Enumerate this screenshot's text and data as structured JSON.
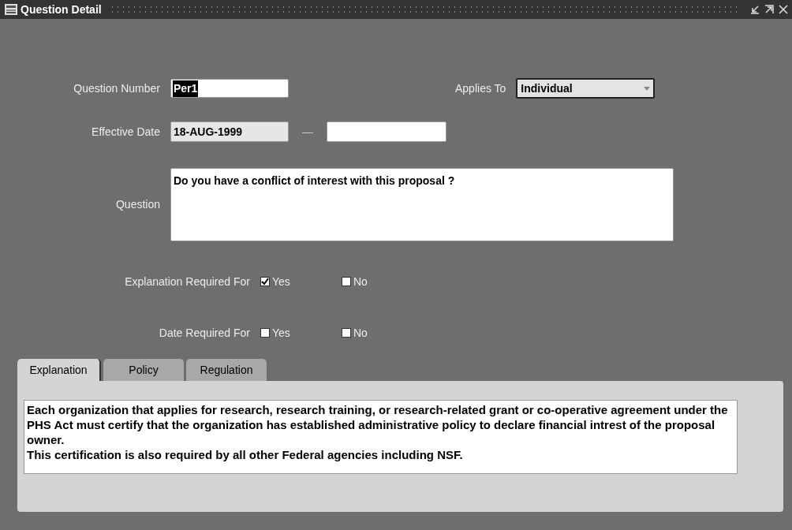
{
  "window": {
    "title": "Question Detail"
  },
  "question_number": {
    "label": "Question Number",
    "value": "Per1",
    "highlighted": true
  },
  "applies_to": {
    "label": "Applies To",
    "value": "Individual"
  },
  "effective_date": {
    "label": "Effective Date",
    "from": "18-AUG-1999",
    "from_readonly": true,
    "separator": "—"
  },
  "question": {
    "label": "Question",
    "value": "Do you have a conflict of interest with this proposal ?"
  },
  "checkbox_rows": [
    {
      "label": "Explanation Required For",
      "options": [
        {
          "label": "Yes",
          "checked": true
        },
        {
          "label": "No",
          "checked": false
        }
      ]
    },
    {
      "label": "Date Required For",
      "options": [
        {
          "label": "Yes",
          "checked": false
        },
        {
          "label": "No",
          "checked": false
        }
      ]
    }
  ],
  "tabs": [
    {
      "label": "Explanation",
      "selected": true
    },
    {
      "label": "Policy",
      "selected": false
    },
    {
      "label": "Regulation",
      "selected": false
    }
  ],
  "explanation_text": [
    "Each organization that applies for research, research training, or research-related grant or co-operative agreement under the PHS Act must certify that the organization has established administrative policy to declare financial intrest of the proposal owner.",
    "This certification is also required by all other Federal agencies including NSF."
  ]
}
